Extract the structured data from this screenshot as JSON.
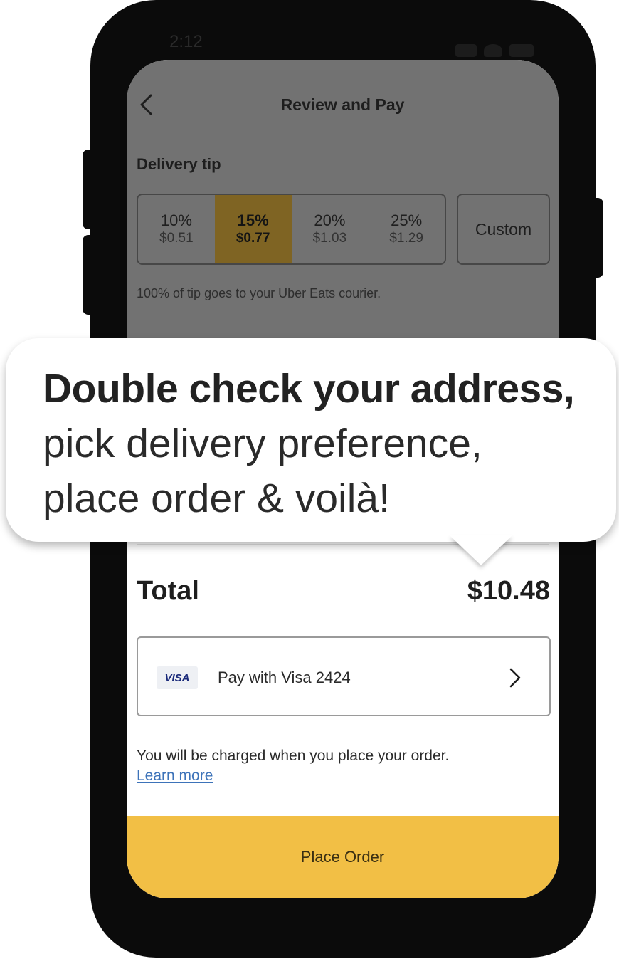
{
  "status_bar": {
    "time": "2:12"
  },
  "header": {
    "title": "Review and Pay"
  },
  "delivery_tip": {
    "title": "Delivery tip",
    "options": [
      {
        "percent": "10%",
        "amount": "$0.51"
      },
      {
        "percent": "15%",
        "amount": "$0.77"
      },
      {
        "percent": "20%",
        "amount": "$1.03"
      },
      {
        "percent": "25%",
        "amount": "$1.29"
      }
    ],
    "selected_index": 1,
    "custom_label": "Custom",
    "note": "100% of tip goes to your Uber Eats courier."
  },
  "summary": {
    "total_label": "Total",
    "total_value": "$10.48"
  },
  "payment": {
    "card_brand": "VISA",
    "label": "Pay with Visa 2424"
  },
  "charge_note": "You will be charged when you place your order.",
  "learn_more": "Learn more",
  "place_order": "Place Order",
  "callout": {
    "headline": "Double check your address,",
    "line2": "pick delivery preference,",
    "line3": "place order & voilà!"
  },
  "colors": {
    "accent": "#f2bf45",
    "selected_tip": "#7f6423",
    "link": "#3d73b9",
    "phone": "#0b0b0b"
  }
}
